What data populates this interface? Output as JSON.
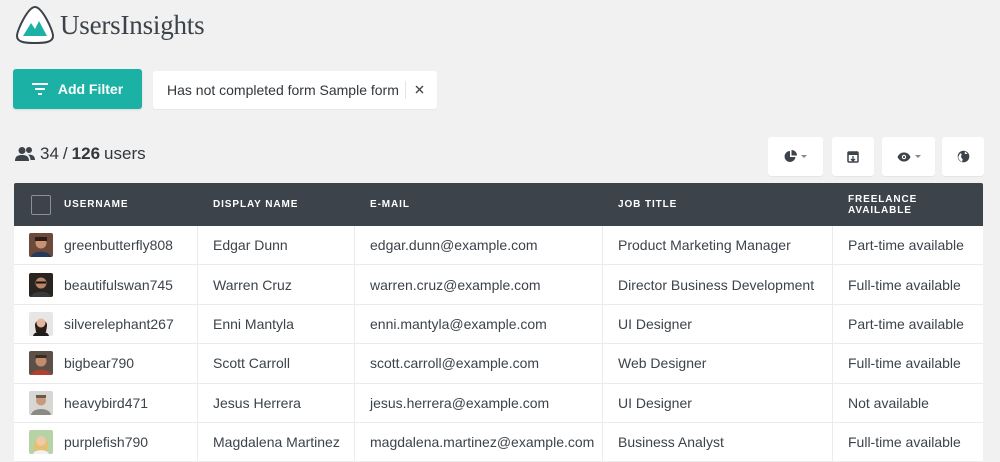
{
  "app": {
    "name": "UsersInsights",
    "brand_color": "#1bb1a5",
    "dark_header": "#3c434a"
  },
  "toolbar": {
    "add_filter_label": "Add Filter",
    "add_filter_icon": "filter-lines-icon",
    "active_filter": "Has not completed form Sample form",
    "remove_filter_icon": "close-icon"
  },
  "summary": {
    "shown": "34",
    "separator": "/",
    "total": "126",
    "unit": "users",
    "icon": "users-icon"
  },
  "tools": [
    {
      "icon": "pie-chart-icon",
      "has_dropdown": true
    },
    {
      "icon": "export-icon",
      "has_dropdown": false
    },
    {
      "icon": "eye-icon",
      "has_dropdown": true
    },
    {
      "icon": "globe-icon",
      "has_dropdown": false
    }
  ],
  "table": {
    "columns": [
      "Username",
      "Display Name",
      "E-mail",
      "Job Title",
      "Freelance Available"
    ],
    "rows": [
      {
        "username": "greenbutterfly808",
        "display_name": "Edgar Dunn",
        "email": "edgar.dunn@example.com",
        "job_title": "Product Marketing Manager",
        "freelance": "Part-time available"
      },
      {
        "username": "beautifulswan745",
        "display_name": "Warren Cruz",
        "email": "warren.cruz@example.com",
        "job_title": "Director Business Development",
        "freelance": "Full-time available"
      },
      {
        "username": "silverelephant267",
        "display_name": "Enni Mantyla",
        "email": "enni.mantyla@example.com",
        "job_title": "UI Designer",
        "freelance": "Part-time available"
      },
      {
        "username": "bigbear790",
        "display_name": "Scott Carroll",
        "email": "scott.carroll@example.com",
        "job_title": "Web Designer",
        "freelance": "Full-time available"
      },
      {
        "username": "heavybird471",
        "display_name": "Jesus Herrera",
        "email": "jesus.herrera@example.com",
        "job_title": "UI Designer",
        "freelance": "Not available"
      },
      {
        "username": "purplefish790",
        "display_name": "Magdalena Martinez",
        "email": "magdalena.martinez@example.com",
        "job_title": "Business Analyst",
        "freelance": "Full-time available"
      }
    ]
  }
}
